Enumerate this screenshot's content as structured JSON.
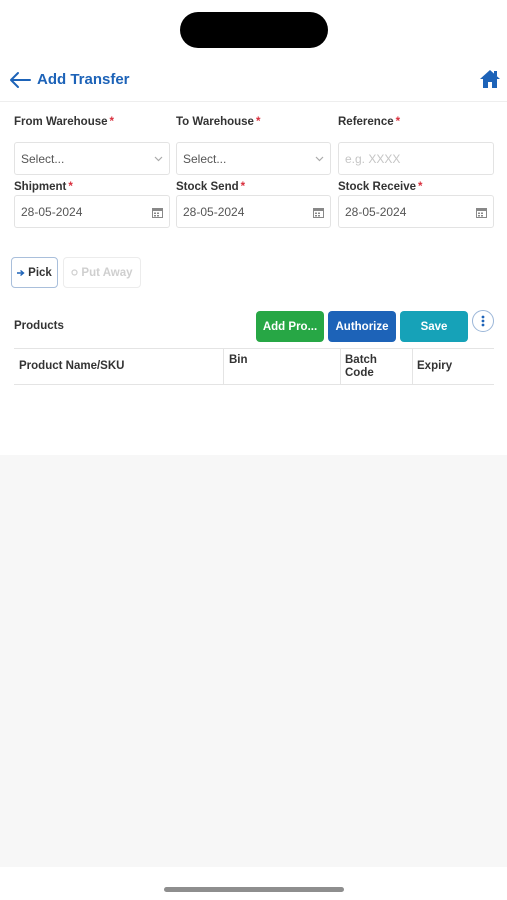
{
  "header": {
    "title": "Add Transfer",
    "back_icon": "arrow-left-icon",
    "home_icon": "home-icon"
  },
  "form": {
    "from_warehouse": {
      "label": "From Warehouse",
      "required": "*",
      "value": "Select..."
    },
    "to_warehouse": {
      "label": "To Warehouse",
      "required": "*",
      "value": "Select..."
    },
    "reference": {
      "label": "Reference",
      "required": "*",
      "placeholder": "e.g. XXXX"
    },
    "shipment": {
      "label": "Shipment",
      "required": "*",
      "value": "28-05-2024"
    },
    "stock_send": {
      "label": "Stock Send",
      "required": "*",
      "value": "28-05-2024"
    },
    "stock_receive": {
      "label": "Stock Receive",
      "required": "*",
      "value": "28-05-2024"
    }
  },
  "tabs": {
    "pick": "Pick",
    "put_away": "Put Away"
  },
  "products": {
    "label": "Products",
    "add_button": "Add Pro...",
    "authorize_button": "Authorize",
    "save_button": "Save"
  },
  "table": {
    "columns": [
      "Product Name/SKU",
      "Bin",
      "Batch\nCode",
      "Expiry"
    ]
  },
  "colors": {
    "primary": "#1d63b8",
    "success": "#27a745",
    "info": "#16a2b8",
    "required": "#d9303e"
  }
}
